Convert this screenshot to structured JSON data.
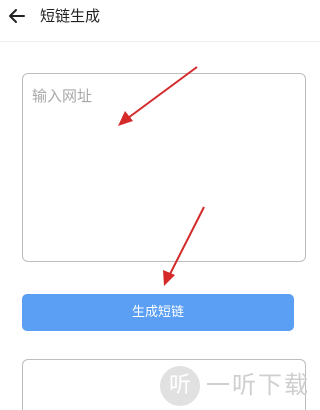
{
  "header": {
    "back_icon": "arrow-left-icon",
    "title": "短链生成"
  },
  "url_input": {
    "placeholder": "输入网址",
    "value": ""
  },
  "generate_button": {
    "label": "生成短链",
    "color": "#5b9ff5"
  },
  "result_box": {
    "value": ""
  },
  "annotation": {
    "arrow_color": "#d42a2a"
  },
  "watermark": {
    "logo_glyph": "听",
    "text": "一听下载"
  }
}
